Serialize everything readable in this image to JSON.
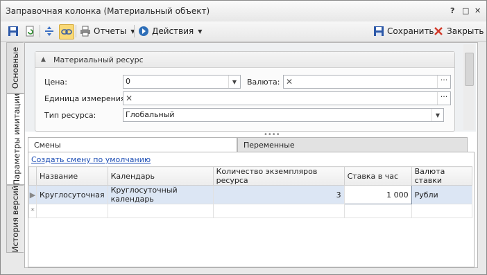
{
  "window": {
    "title": "Заправочная колонка (Материальный объект)",
    "controls": [
      "?",
      "□",
      "✕"
    ]
  },
  "toolbar": {
    "reports_label": "Отчеты",
    "actions_label": "Действия",
    "save_label": "Сохранить",
    "close_label": "Закрыть"
  },
  "side_tabs": [
    "Основные",
    "Параметры имитации",
    "История версий"
  ],
  "group": {
    "title": "Материальный ресурс",
    "price_label": "Цена:",
    "price_value": "0",
    "currency_label": "Валюта:",
    "currency_value": "",
    "unit_label": "Единица измерения:",
    "unit_value": "",
    "type_label": "Тип ресурса:",
    "type_value": "Глобальный"
  },
  "tabs": [
    "Смены",
    "Переменные"
  ],
  "shifts": {
    "create_link": "Создать смену по умолчанию",
    "columns": [
      "Название",
      "Календарь",
      "Количество экземпляров ресурса",
      "Ставка в час",
      "Валюта ставки"
    ],
    "rows": [
      [
        "Круглосуточная",
        "Круглосуточный календарь",
        "3",
        "1 000",
        "Рубли"
      ]
    ],
    "new_row_marker": "*"
  }
}
